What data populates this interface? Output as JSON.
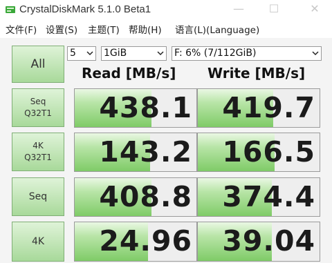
{
  "window": {
    "title": "CrystalDiskMark 5.1.0 Beta1",
    "icons": [
      "app-icon",
      "minimize-icon",
      "maximize-icon",
      "close-icon"
    ]
  },
  "menu": [
    "文件(F)",
    "设置(S)",
    "主题(T)",
    "帮助(H)",
    "语言(L)(Language)"
  ],
  "controls": {
    "all_label": "All",
    "count": "5",
    "size": "1GiB",
    "drive": "F: 6% (7/112GiB)"
  },
  "headers": {
    "read": "Read [MB/s]",
    "write": "Write [MB/s]"
  },
  "tests": [
    {
      "line1": "Seq",
      "line2": "Q32T1",
      "read": "438.1",
      "write": "419.7",
      "read_fill": 0.63,
      "write_fill": 0.62
    },
    {
      "line1": "4K",
      "line2": "Q32T1",
      "read": "143.2",
      "write": "166.5",
      "read_fill": 0.62,
      "write_fill": 0.63
    },
    {
      "line1": "Seq",
      "line2": "",
      "read": "408.8",
      "write": "374.4",
      "read_fill": 0.63,
      "write_fill": 0.61
    },
    {
      "line1": "4K",
      "line2": "",
      "read": "24.96",
      "write": "39.04",
      "read_fill": 0.6,
      "write_fill": 0.61
    }
  ],
  "colors": {
    "accent_green": "#7fcb67",
    "button_green": "#a8d99a"
  }
}
